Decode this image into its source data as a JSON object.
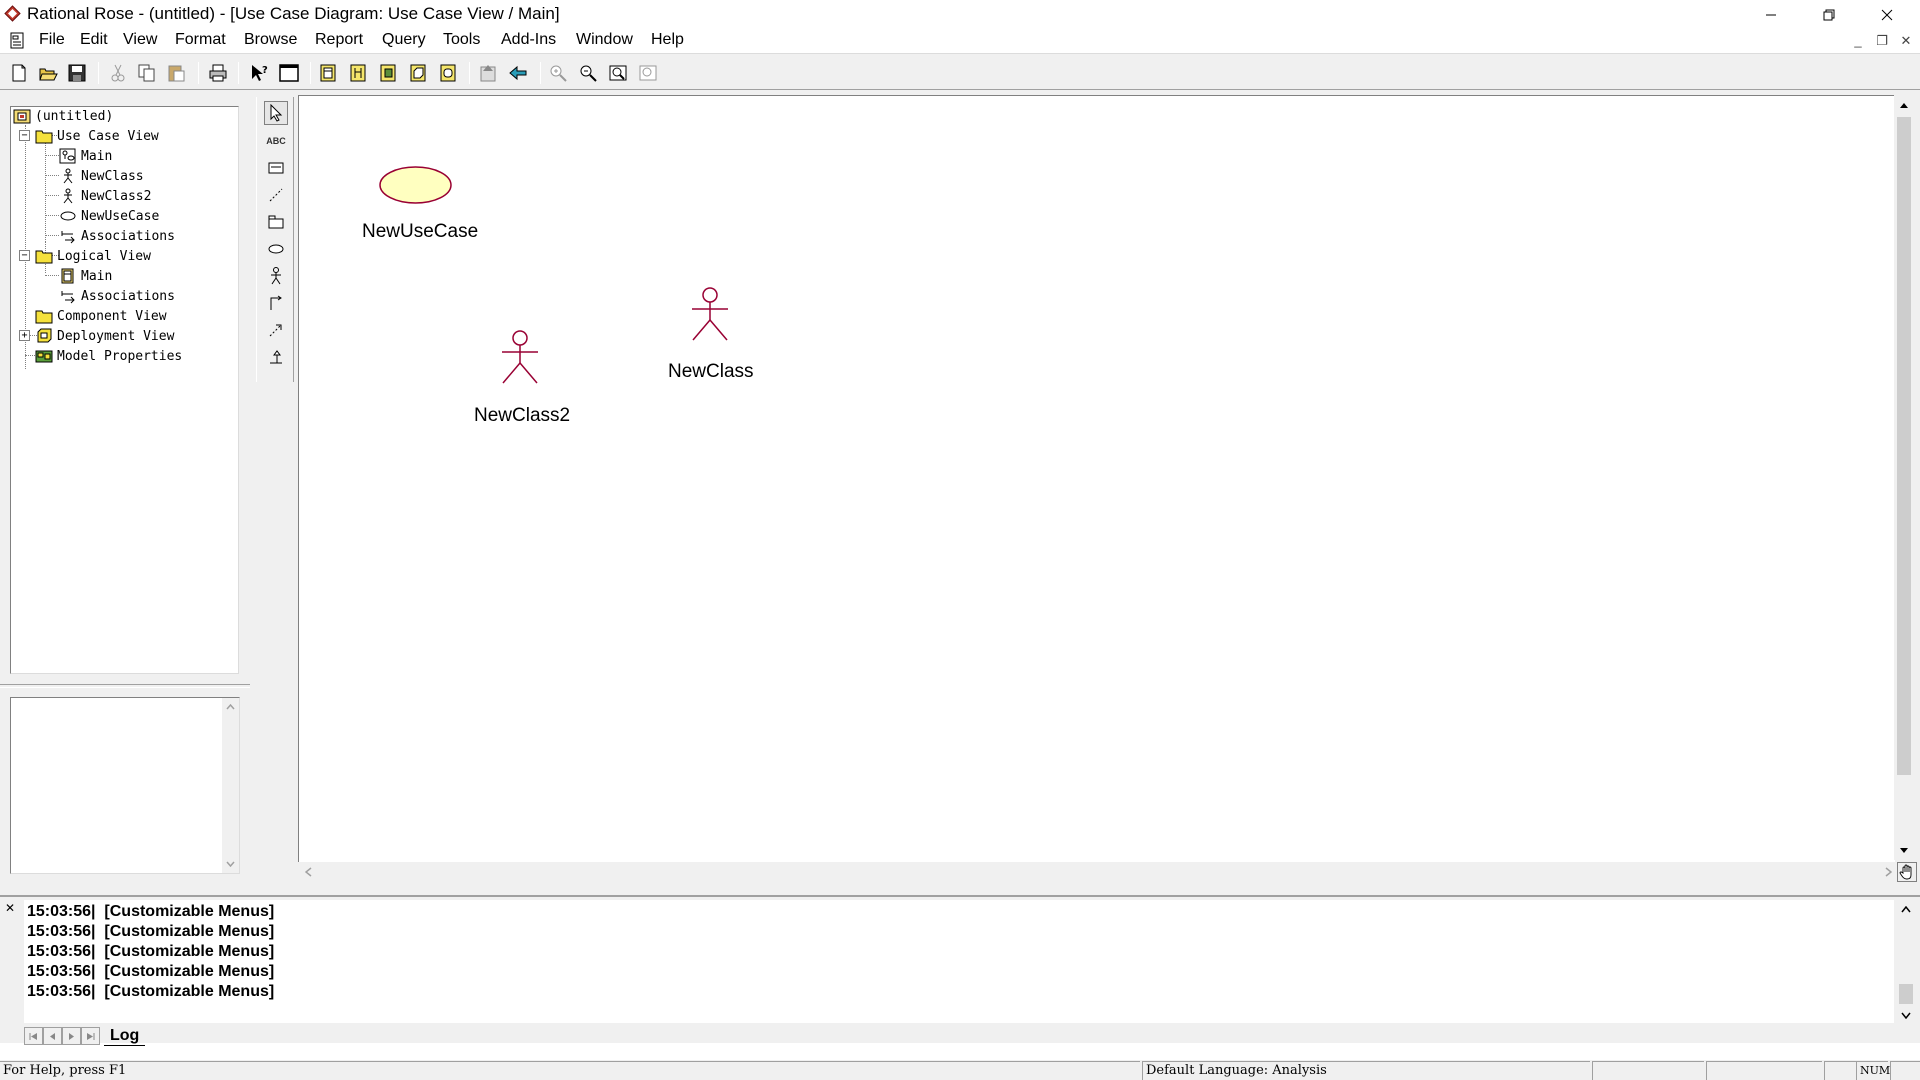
{
  "window": {
    "title": "Rational Rose - (untitled) - [Use Case Diagram: Use Case View / Main]"
  },
  "menu": {
    "items": [
      "File",
      "Edit",
      "View",
      "Format",
      "Browse",
      "Report",
      "Query",
      "Tools",
      "Add-Ins",
      "Window",
      "Help"
    ]
  },
  "toolbar": {
    "buttons": [
      "new-icon",
      "open-icon",
      "save-icon",
      "cut-icon",
      "copy-icon",
      "paste-icon",
      "print-icon",
      "context-help-icon",
      "view-documentation-icon",
      "browse-class-diagram-icon",
      "browse-interaction-diagram-icon",
      "browse-component-diagram-icon",
      "browse-deployment-diagram-icon",
      "browse-parent-icon",
      "browse-previous-diagram-icon",
      "zoom-in-icon",
      "zoom-out-icon",
      "fit-in-window-icon",
      "undo-fit-icon"
    ]
  },
  "browser": {
    "root": "(untitled)",
    "items": [
      {
        "label": "Use Case View",
        "icon": "folder-icon",
        "level": 1,
        "expander": "−"
      },
      {
        "label": "Main",
        "icon": "usecase-diagram-icon",
        "level": 2
      },
      {
        "label": "NewClass",
        "icon": "actor-icon",
        "level": 2
      },
      {
        "label": "NewClass2",
        "icon": "actor-icon",
        "level": 2
      },
      {
        "label": "NewUseCase",
        "icon": "usecase-icon",
        "level": 2
      },
      {
        "label": "Associations",
        "icon": "associations-icon",
        "level": 2
      },
      {
        "label": "Logical View",
        "icon": "folder-icon",
        "level": 1,
        "expander": "−"
      },
      {
        "label": "Main",
        "icon": "class-diagram-icon",
        "level": 2
      },
      {
        "label": "Associations",
        "icon": "associations-icon",
        "level": 2
      },
      {
        "label": "Component View",
        "icon": "folder-icon",
        "level": 1,
        "expander": "+"
      },
      {
        "label": "Deployment View",
        "icon": "deployment-icon",
        "level": 1
      },
      {
        "label": "Model Properties",
        "icon": "model-properties-icon",
        "level": 1
      }
    ]
  },
  "diagram_toolbox": {
    "text_tool_label": "ABC"
  },
  "diagram": {
    "usecases": [
      {
        "name": "NewUseCase",
        "fill": "#ffffc0",
        "stroke": "#990033"
      }
    ],
    "actors": [
      {
        "name": "NewClass",
        "stroke": "#990033"
      },
      {
        "name": "NewClass2",
        "stroke": "#990033"
      }
    ]
  },
  "log": {
    "lines": [
      "15:03:56|  [Customizable Menus]",
      "15:03:56|  [Customizable Menus]",
      "15:03:56|  [Customizable Menus]",
      "15:03:56|  [Customizable Menus]",
      "15:03:56|  [Customizable Menus]"
    ],
    "tab_label": "Log"
  },
  "statusbar": {
    "help_text": "For Help, press F1",
    "language": "Default Language: Analysis",
    "num_indicator": "NUM"
  }
}
